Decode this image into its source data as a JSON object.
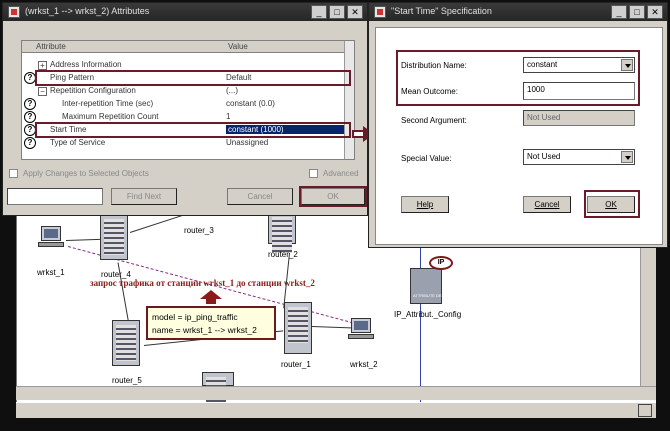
{
  "attributes_dialog": {
    "title": "(wrkst_1 --> wrkst_2) Attributes",
    "columns": {
      "attribute": "Attribute",
      "value": "Value"
    },
    "rows": [
      {
        "name": "Address Information",
        "value": ""
      },
      {
        "name": "Ping Pattern",
        "value": "Default"
      },
      {
        "name": "Repetition Configuration",
        "value": "(...)"
      },
      {
        "name": "Inter-repetition Time (sec)",
        "value": "constant (0.0)"
      },
      {
        "name": "Maximum Repetition Count",
        "value": "1"
      },
      {
        "name": "Start Time",
        "value": "constant (1000)"
      },
      {
        "name": "Type of Service",
        "value": "Unassigned"
      }
    ],
    "apply_changes_label": "Apply Changes to Selected Objects",
    "advanced_label": "Advanced",
    "find_next_label": "Find Next",
    "cancel_label": "Cancel",
    "ok_label": "OK",
    "help_glyph": "?",
    "tree_plus": "+",
    "tree_minus": "−",
    "window_buttons": {
      "minimize": "_",
      "maximize": "□",
      "close": "✕"
    }
  },
  "start_time_dialog": {
    "title": "\"Start Time\" Specification",
    "distribution_name_label": "Distribution Name:",
    "distribution_name_value": "constant",
    "mean_outcome_label": "Mean Outcome:",
    "mean_outcome_value": "1000",
    "second_argument_label": "Second Argument:",
    "second_argument_value": "Not Used",
    "special_value_label": "Special Value:",
    "special_value_value": "Not Used",
    "help_label": "Help",
    "cancel_label": "Cancel",
    "ok_label": "OK",
    "window_buttons": {
      "minimize": "_",
      "maximize": "□",
      "close": "✕"
    }
  },
  "network": {
    "nodes": {
      "wrkst_1": "wrkst_1",
      "router_4": "router_4",
      "router_3": "router_3",
      "router_2": "router_2",
      "router_5": "router_5",
      "router_1": "router_1",
      "wrkst_2": "wrkst_2",
      "ip_config": "IP_Attribut._Config",
      "ip_badge": "IP",
      "ip_box_caption": "ATTRIBUTE DEFINITION"
    },
    "traffic_annotation": "запрос трафика от станции wrkst_1 до станции wrkst_2",
    "model_line": "model = ip_ping_traffic",
    "name_line": "name = wrkst_1 --> wrkst_2"
  },
  "colors": {
    "highlight": "#6b1a2a",
    "selection": "#0a246a",
    "annotation": "#8b1a1a"
  }
}
